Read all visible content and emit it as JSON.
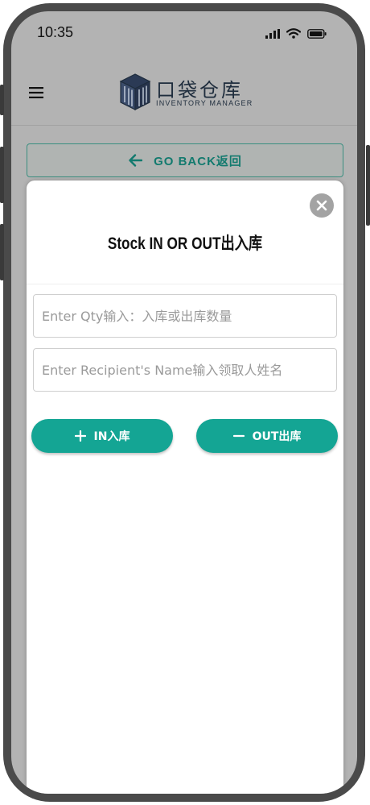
{
  "status_bar": {
    "time": "10:35",
    "icons": [
      "signal-icon",
      "wifi-icon",
      "battery-icon"
    ]
  },
  "header": {
    "menu_icon": "hamburger-menu-icon",
    "logo_title": "口袋仓库",
    "logo_subtitle": "Inventory Manager"
  },
  "nav": {
    "go_back_label": "GO BACK返回",
    "go_back_icon": "arrow-left-icon"
  },
  "modal": {
    "title": "Stock IN OR OUT出入库",
    "close_icon": "close-icon",
    "qty_placeholder": "Enter Qty输入：入库或出库数量",
    "recipient_placeholder": "Enter Recipient's Name输入领取人姓名",
    "in_button_label": "IN入库",
    "out_button_label": "OUT出库"
  },
  "colors": {
    "accent": "#14a594",
    "accent_dark": "#127a6e",
    "overlay": "#b3b3b3",
    "logo": "#1f2d3d"
  }
}
